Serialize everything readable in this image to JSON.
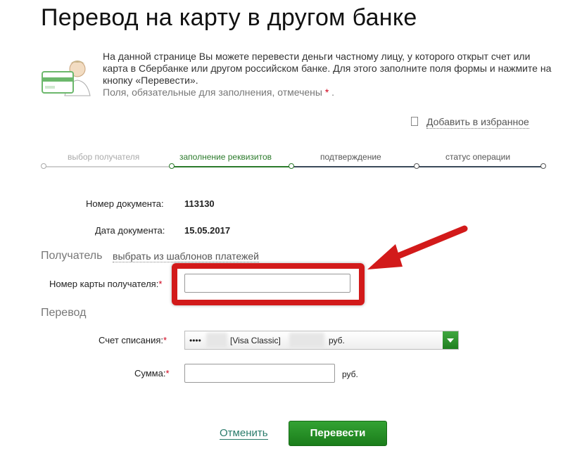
{
  "page": {
    "title": "Перевод на карту в другом банке",
    "info": {
      "text": "На данной странице Вы можете перевести деньги частному лицу, у которого открыт счет или карта в Сбербанке или другом российском банке. Для этого заполните поля формы и нажмите на кнопку «Перевести».",
      "required_note": "Поля, обязательные для заполнения, отмечены",
      "required_mark": "*",
      "required_end": "."
    },
    "favorites": {
      "label": "Добавить в избранное",
      "icon": "bookmark-icon"
    },
    "steps": [
      {
        "label": "выбор получателя",
        "state": "past"
      },
      {
        "label": "заполнение реквизитов",
        "state": "current"
      },
      {
        "label": "подтверждение",
        "state": "future"
      },
      {
        "label": "статус операции",
        "state": "future"
      }
    ],
    "colors": {
      "accent": "#2b7a2b",
      "highlight": "#d21a1a",
      "button": "#1f8a1f"
    }
  },
  "document": {
    "number_label": "Номер документа:",
    "number_value": "113130",
    "date_label": "Дата документа:",
    "date_value": "15.05.2017"
  },
  "recipient": {
    "section_title": "Получатель",
    "template_link": "выбрать из шаблонов платежей",
    "card_label": "Номер карты получателя:",
    "card_required": "*",
    "card_value": "",
    "card_placeholder": ""
  },
  "transfer": {
    "section_title": "Перевод",
    "account_label": "Счет списания:",
    "account_required": "*",
    "account_masked": "••••",
    "account_card_type": "[Visa Classic]",
    "account_currency": "руб.",
    "amount_label": "Сумма:",
    "amount_required": "*",
    "amount_value": "",
    "amount_currency": "руб."
  },
  "actions": {
    "cancel_label": "Отменить",
    "submit_label": "Перевести"
  }
}
